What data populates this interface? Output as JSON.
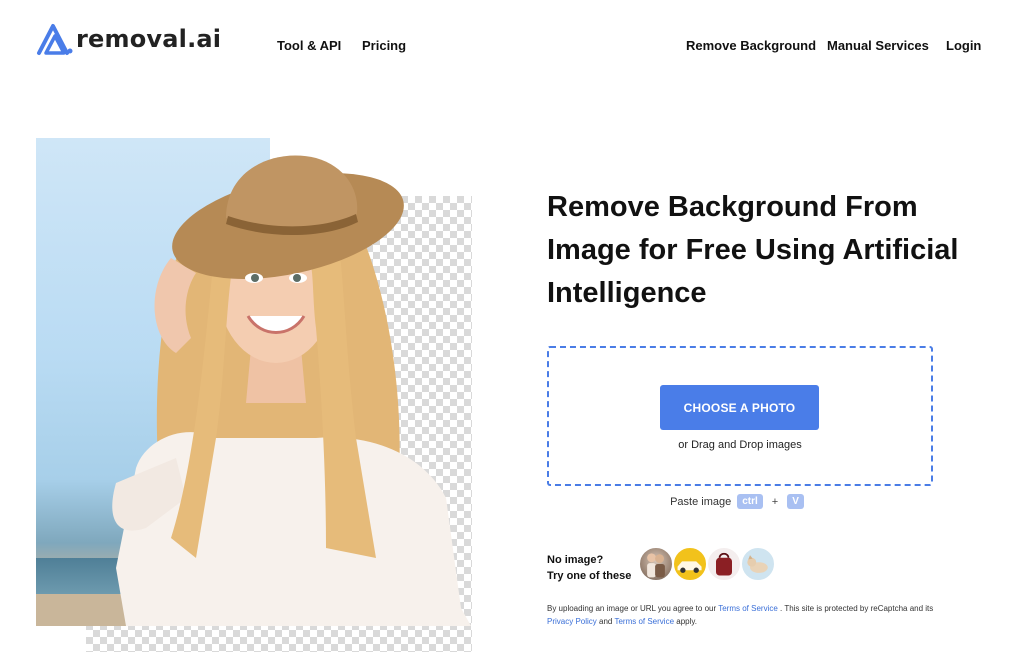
{
  "header": {
    "logo_text": "removal.ai",
    "nav_left": [
      {
        "label": "Tool & API"
      },
      {
        "label": "Pricing"
      }
    ],
    "nav_right": [
      {
        "label": "Remove Background"
      },
      {
        "label": "Manual Services"
      },
      {
        "label": "Login"
      }
    ]
  },
  "hero": {
    "headline": "Remove Background From Image for Free Using Artificial Intelligence"
  },
  "upload": {
    "choose_button": "CHOOSE A PHOTO",
    "drag_text": "or Drag and Drop images",
    "paste_label": "Paste image",
    "key_ctrl": "ctrl",
    "key_plus": "+",
    "key_v": "V"
  },
  "samples": {
    "line1": "No image?",
    "line2": "Try one of these",
    "items": [
      {
        "icon": "sample-couple-thumbnail"
      },
      {
        "icon": "sample-car-thumbnail"
      },
      {
        "icon": "sample-bag-thumbnail"
      },
      {
        "icon": "sample-dog-thumbnail"
      }
    ]
  },
  "legal": {
    "part1": "By uploading an image or URL you agree to our ",
    "terms1": "Terms of Service",
    "part2": " . This site is protected by reCaptcha and its ",
    "privacy": "Privacy Policy",
    "part3": " and ",
    "terms2": "Terms of Service",
    "part4": " apply."
  },
  "colors": {
    "accent": "#4a7de8",
    "dropzone_border": "#4a7de6",
    "key_bg": "#a9c0f2",
    "link": "#3a6fd8"
  }
}
